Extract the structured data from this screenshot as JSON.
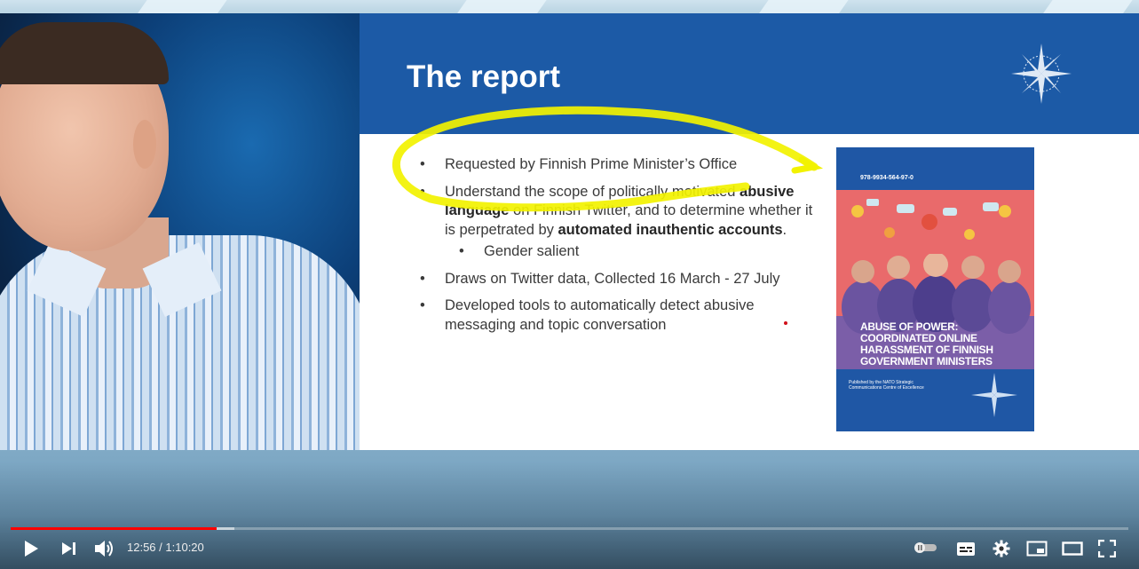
{
  "slide": {
    "title": "The report",
    "bullets": {
      "b1": "Requested by Finnish Prime Minister’s Office",
      "b2_part1": "Understand the scope of politically motivated ",
      "b2_bold1": "abusive language",
      "b2_part2": " on Finnish Twitter, and to determine whether it is perpetrated by ",
      "b2_bold2": "automated inauthentic accounts",
      "b2_end": ".",
      "sub1": "Gender salient",
      "b3": "Draws on Twitter data, Collected 16 March -  27 July",
      "b4": "Developed tools to automatically detect abusive messaging and topic conversation"
    },
    "cover": {
      "isbn": "978-9934-564-97-0",
      "title": "ABUSE OF POWER: COORDINATED ONLINE HARASSMENT OF FINNISH GOVERNMENT MINISTERS",
      "publisher": "Published by the NATO Strategic Communications Centre of Excellence"
    },
    "colors": {
      "header_blue": "#1c5aa6",
      "highlight": "#f2f200",
      "cover_blue": "#1f57a5",
      "cover_pink": "#e96a6b"
    }
  },
  "player": {
    "time_current": "12:56",
    "time_separator": " / ",
    "time_total": "1:10:20",
    "progress": 0.184,
    "buffered": 0.2,
    "progress_color": "#ff0000",
    "icons": {
      "play": "play-icon",
      "next": "next-icon",
      "volume": "volume-icon",
      "autoplay": "autoplay-toggle-icon",
      "subtitles": "subtitles-icon",
      "settings": "settings-gear-icon",
      "miniplayer": "miniplayer-icon",
      "theater": "theater-mode-icon",
      "fullscreen": "fullscreen-icon"
    }
  }
}
